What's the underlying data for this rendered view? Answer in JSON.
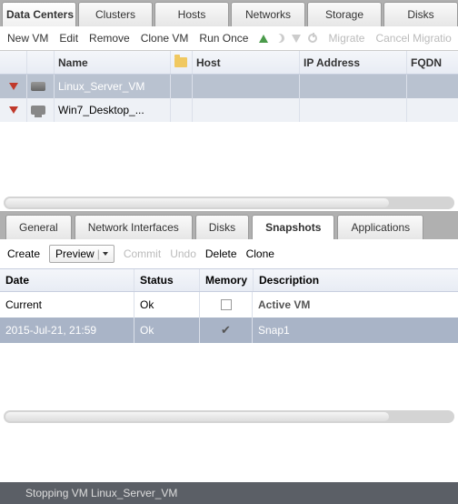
{
  "topTabs": [
    {
      "label": "Data Centers",
      "active": true
    },
    {
      "label": "Clusters"
    },
    {
      "label": "Hosts"
    },
    {
      "label": "Networks"
    },
    {
      "label": "Storage"
    },
    {
      "label": "Disks"
    }
  ],
  "toolbar": {
    "newVm": "New VM",
    "edit": "Edit",
    "remove": "Remove",
    "cloneVm": "Clone VM",
    "runOnce": "Run Once",
    "migrate": "Migrate",
    "cancelMigration": "Cancel Migratio"
  },
  "vmColumns": {
    "name": "Name",
    "host": "Host",
    "ip": "IP Address",
    "fqdn": "FQDN"
  },
  "vmRows": [
    {
      "name": "Linux_Server_VM",
      "type": "server",
      "selected": true
    },
    {
      "name": "Win7_Desktop_...",
      "type": "desktop",
      "selected": false
    }
  ],
  "subTabs": [
    {
      "label": "General"
    },
    {
      "label": "Network Interfaces"
    },
    {
      "label": "Disks"
    },
    {
      "label": "Snapshots",
      "active": true
    },
    {
      "label": "Applications"
    }
  ],
  "snapToolbar": {
    "create": "Create",
    "preview": "Preview",
    "commit": "Commit",
    "undo": "Undo",
    "delete": "Delete",
    "clone": "Clone"
  },
  "snapColumns": {
    "date": "Date",
    "status": "Status",
    "memory": "Memory",
    "desc": "Description"
  },
  "snapRows": [
    {
      "date": "Current",
      "status": "Ok",
      "memory": false,
      "desc": "Active VM",
      "selected": false,
      "bold": true
    },
    {
      "date": "2015-Jul-21, 21:59",
      "status": "Ok",
      "memory": true,
      "desc": "Snap1",
      "selected": true
    }
  ],
  "statusBar": "Stopping VM Linux_Server_VM"
}
